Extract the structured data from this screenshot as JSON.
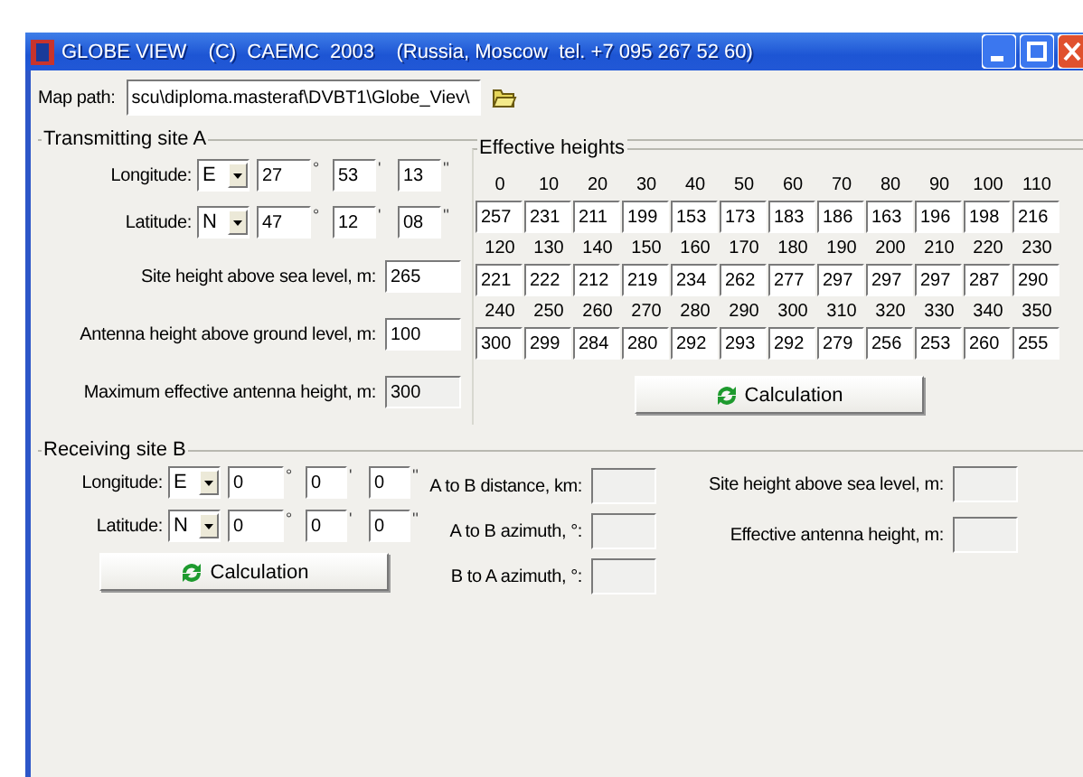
{
  "window": {
    "title": "GLOBE VIEW    (C)  CAEMC  2003    (Russia, Moscow  tel. +7 095 267 52 60)"
  },
  "map_path": {
    "label": "Map path:",
    "value": "scu\\diploma.masteraf\\DVBT1\\Globe_Viev\\"
  },
  "site_a": {
    "title": "Transmitting site A",
    "coordinates": [
      {
        "label": "Longitude:",
        "hemisphere": "E",
        "parts": [
          {
            "value": "27",
            "unit": "°"
          },
          {
            "value": "53",
            "unit": "'"
          },
          {
            "value": "13",
            "unit": "''"
          }
        ]
      },
      {
        "label": "Latitude:",
        "hemisphere": "N",
        "parts": [
          {
            "value": "47",
            "unit": "°"
          },
          {
            "value": "12",
            "unit": "'"
          },
          {
            "value": "08",
            "unit": "''"
          }
        ]
      }
    ],
    "fields": [
      {
        "label": "Site height above sea level, m:",
        "value": "265",
        "readonly": false
      },
      {
        "label": "Antenna height above ground level, m:",
        "value": "100",
        "readonly": false
      },
      {
        "label": "Maximum effective antenna height, m:",
        "value": "300",
        "readonly": true
      }
    ],
    "effective_heights": {
      "title": "Effective heights",
      "rows": [
        {
          "angles": [
            "0",
            "10",
            "20",
            "30",
            "40",
            "50",
            "60",
            "70",
            "80",
            "90",
            "100",
            "110"
          ],
          "heights": [
            "257",
            "231",
            "211",
            "199",
            "153",
            "173",
            "183",
            "186",
            "163",
            "196",
            "198",
            "216"
          ]
        },
        {
          "angles": [
            "120",
            "130",
            "140",
            "150",
            "160",
            "170",
            "180",
            "190",
            "200",
            "210",
            "220",
            "230"
          ],
          "heights": [
            "221",
            "222",
            "212",
            "219",
            "234",
            "262",
            "277",
            "297",
            "297",
            "297",
            "287",
            "290"
          ]
        },
        {
          "angles": [
            "240",
            "250",
            "260",
            "270",
            "280",
            "290",
            "300",
            "310",
            "320",
            "330",
            "340",
            "350"
          ],
          "heights": [
            "300",
            "299",
            "284",
            "280",
            "292",
            "293",
            "292",
            "279",
            "256",
            "253",
            "260",
            "255"
          ]
        }
      ]
    },
    "button": "Calculation"
  },
  "site_b": {
    "title": "Receiving site B",
    "coordinates": [
      {
        "label": "Longitude:",
        "hemisphere": "E",
        "parts": [
          {
            "value": "0",
            "unit": "°"
          },
          {
            "value": "0",
            "unit": "'"
          },
          {
            "value": "0",
            "unit": "''"
          }
        ]
      },
      {
        "label": "Latitude:",
        "hemisphere": "N",
        "parts": [
          {
            "value": "0",
            "unit": "°"
          },
          {
            "value": "0",
            "unit": "'"
          },
          {
            "value": "0",
            "unit": "''"
          }
        ]
      }
    ],
    "button": "Calculation",
    "results": [
      {
        "label": "A to B distance, km:"
      },
      {
        "label": "A to B azimuth, °:"
      },
      {
        "label": "B to A azimuth, °:"
      }
    ],
    "site_results": [
      {
        "label": "Site height above sea level, m:"
      },
      {
        "label": "Effective antenna height, m:"
      }
    ]
  }
}
